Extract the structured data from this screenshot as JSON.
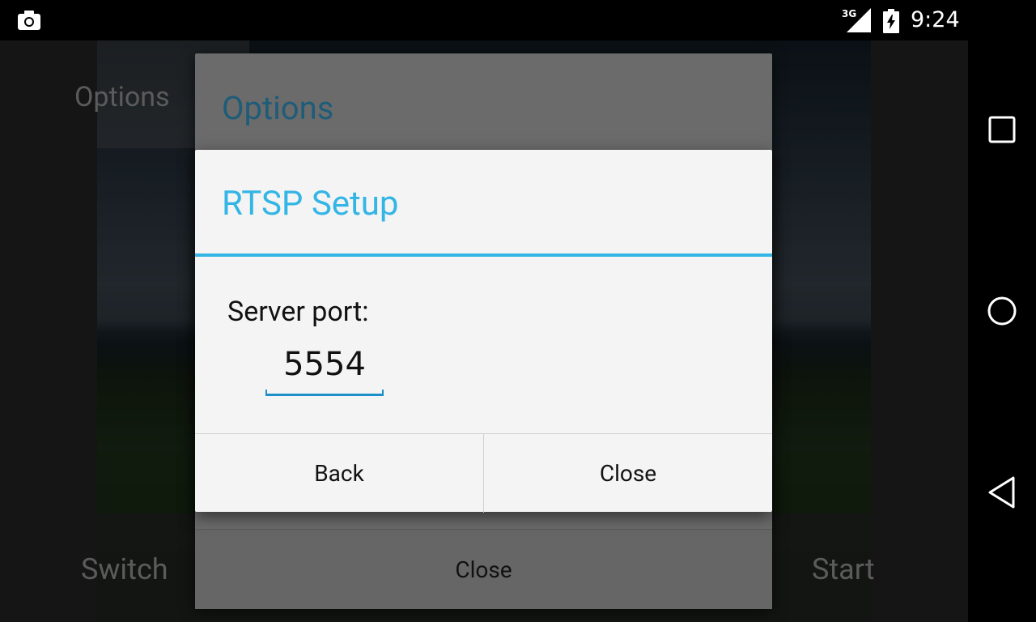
{
  "status_bar": {
    "time": "9:24",
    "network": "3G",
    "icons": [
      "camera-icon",
      "signal-icon",
      "battery-charging-icon"
    ]
  },
  "camera_screen": {
    "options_label": "Options",
    "switch_label": "Switch",
    "start_label": "Start"
  },
  "options_dialog": {
    "title": "Options",
    "close_label": "Close"
  },
  "rtsp_dialog": {
    "title": "RTSP Setup",
    "server_port_label": "Server port:",
    "server_port_value": "5554",
    "back_label": "Back",
    "close_label": "Close",
    "accent_color": "#33b5e5"
  },
  "nav_bar": {
    "icons": [
      "recents-icon",
      "home-icon",
      "back-icon"
    ]
  }
}
